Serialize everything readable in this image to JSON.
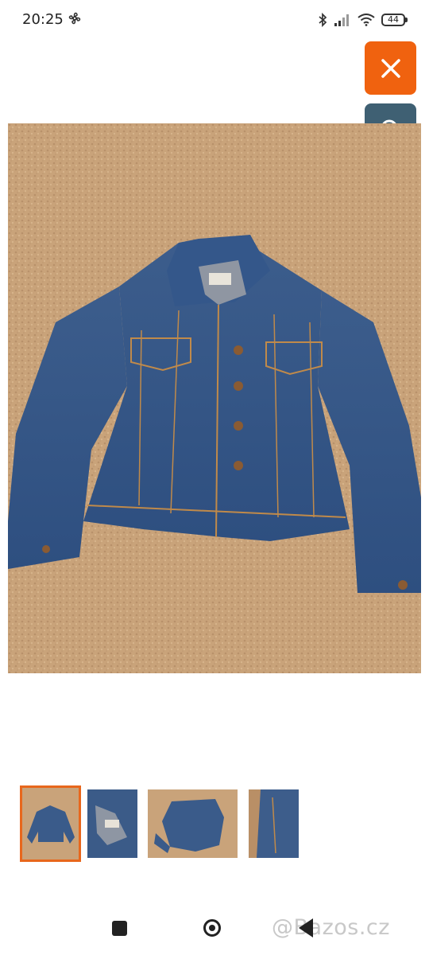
{
  "status_bar": {
    "time": "20:25",
    "battery": "44",
    "icons": [
      "fan-icon",
      "bluetooth-icon",
      "signal-icon",
      "wifi-icon",
      "battery-icon"
    ]
  },
  "overlay_buttons": {
    "close_icon": "close-icon",
    "zoom_icon": "zoom-in-icon",
    "close_color": "#f0620f",
    "zoom_color": "#3f6073"
  },
  "gallery": {
    "main_image": "denim-jacket-photo",
    "selected_index": 0,
    "thumbnails": [
      "thumbnail-front",
      "thumbnail-label",
      "thumbnail-back",
      "thumbnail-side"
    ],
    "accent": "#e8671c"
  },
  "watermark": "@Bazos.cz"
}
